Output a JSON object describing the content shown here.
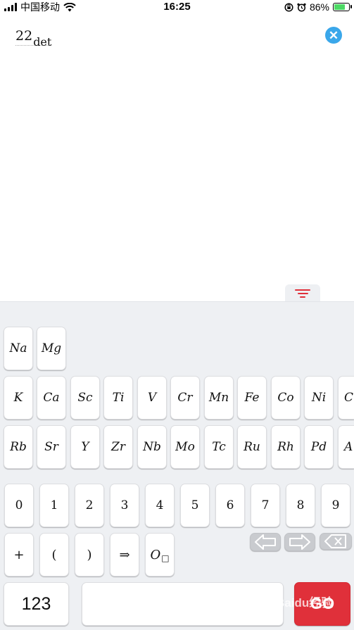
{
  "status_bar": {
    "carrier": "中国移动",
    "time": "16:25",
    "battery_percent": "86%",
    "battery_level": 0.86,
    "icons": [
      "signal-icon",
      "wifi-icon",
      "lock-rotation-icon",
      "alarm-icon",
      "battery-charging-icon"
    ]
  },
  "formula": {
    "number": "22",
    "subscript": "det"
  },
  "clear_button": {
    "symbol": "✕",
    "color": "#3aa7ea"
  },
  "keyboard_toggle": {
    "icon": "filter-icon",
    "color": "#e0303a"
  },
  "elements": {
    "row1": [
      "Na",
      "Mg"
    ],
    "row2": [
      "K",
      "Ca",
      "Sc",
      "Ti",
      "V",
      "Cr",
      "Mn",
      "Fe",
      "Co",
      "Ni",
      "C"
    ],
    "row3": [
      "Rb",
      "Sr",
      "Y",
      "Zr",
      "Nb",
      "Mo",
      "Tc",
      "Ru",
      "Rh",
      "Pd",
      "A"
    ]
  },
  "digits": [
    "0",
    "1",
    "2",
    "3",
    "4",
    "5",
    "6",
    "7",
    "8",
    "9"
  ],
  "operators": {
    "plus": "+",
    "open_paren": "(",
    "close_paren": ")",
    "arrow": "⇒",
    "o_sub": "O",
    "o_box": "□"
  },
  "nav": {
    "left_arrow": "⇦",
    "right_arrow": "⇨",
    "backspace": "⌫"
  },
  "bottom": {
    "mode_label": "123",
    "go_label": "GO",
    "watermark": "Baidu经验"
  },
  "colors": {
    "accent": "#e0303a",
    "clear": "#3aa7ea",
    "key_gray": "#c9cbcf"
  }
}
